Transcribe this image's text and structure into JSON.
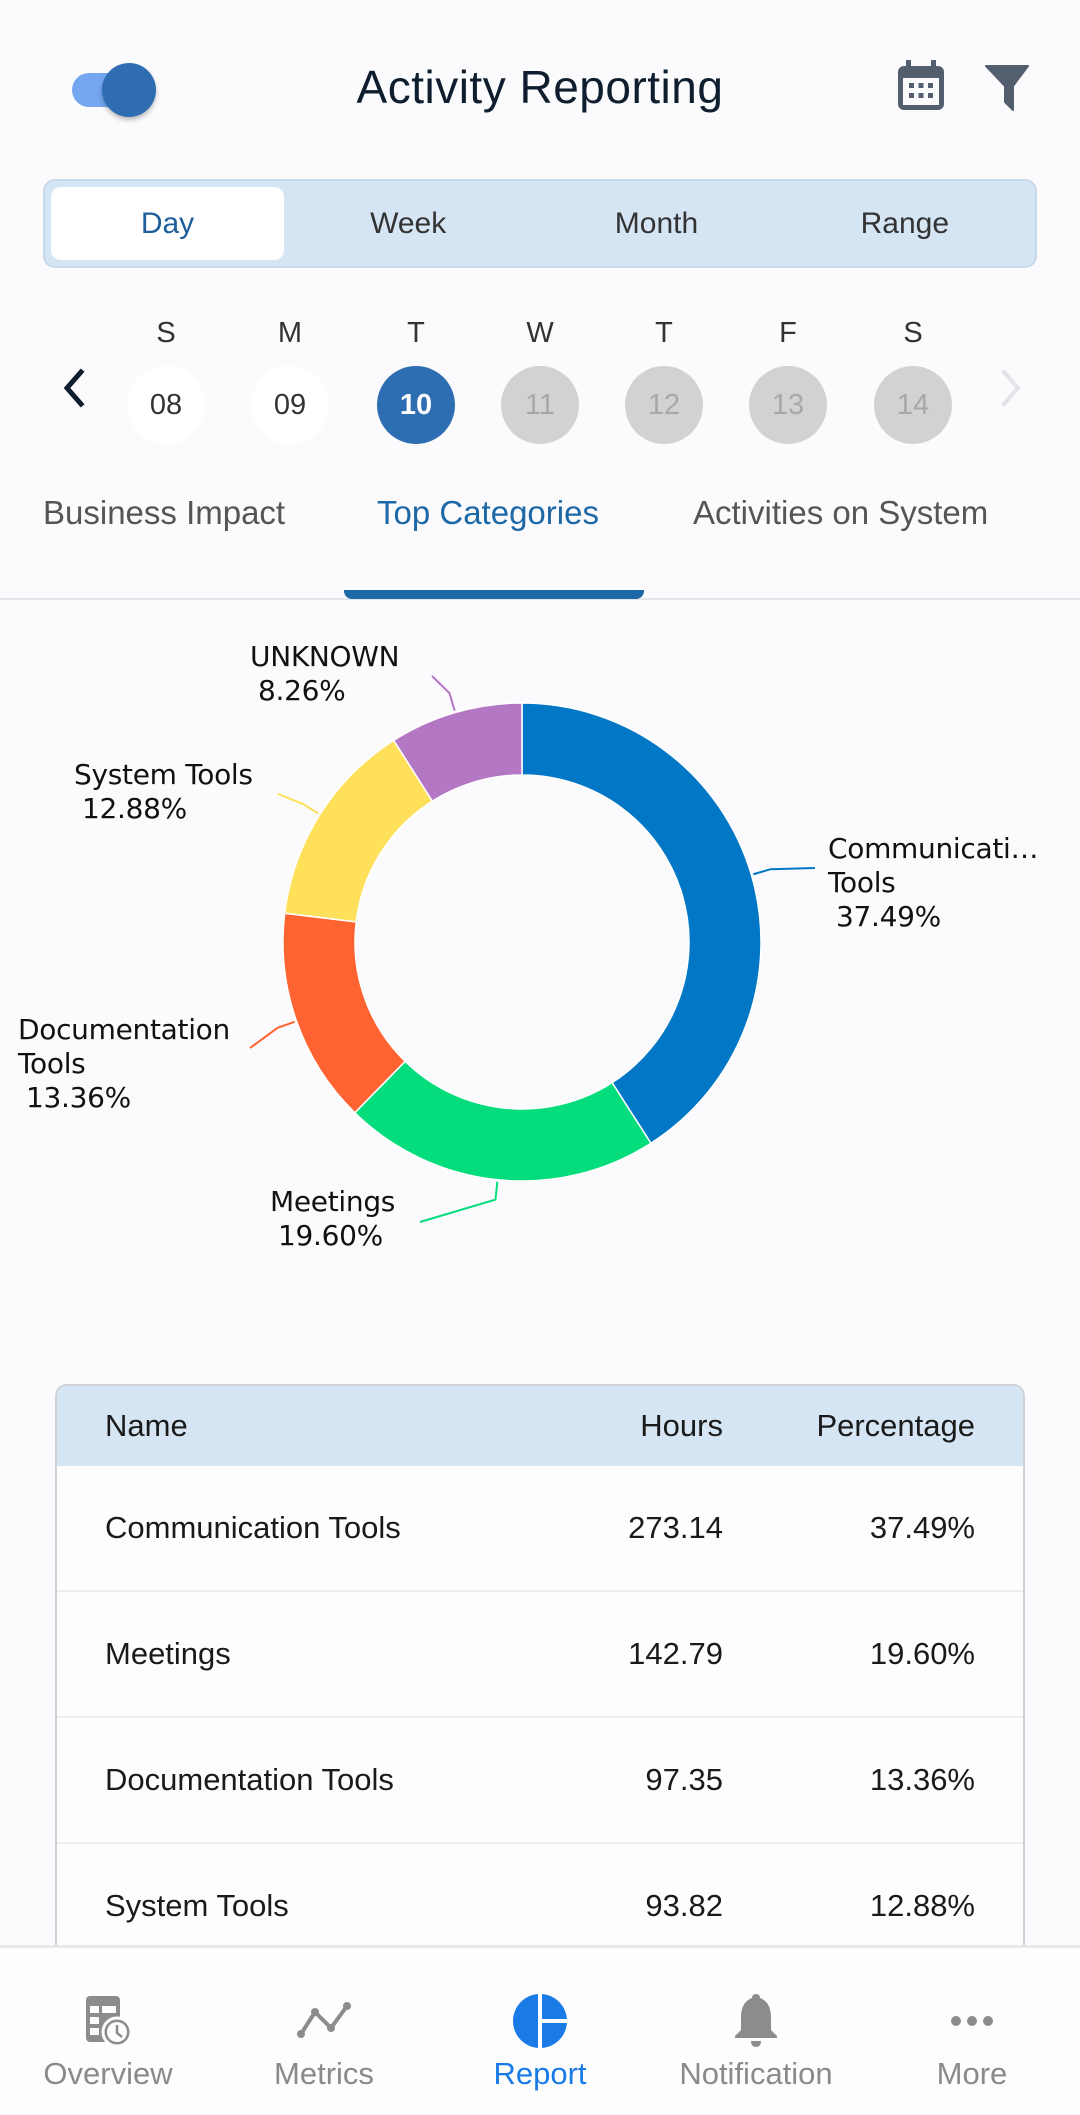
{
  "header": {
    "title": "Activity Reporting",
    "toggle_state": "on",
    "icons": [
      "calendar-icon",
      "filter-icon"
    ]
  },
  "period_tabs": [
    {
      "label": "Day",
      "active": true
    },
    {
      "label": "Week",
      "active": false
    },
    {
      "label": "Month",
      "active": false
    },
    {
      "label": "Range",
      "active": false
    }
  ],
  "date_strip": {
    "days": [
      {
        "dow": "S",
        "num": "08",
        "state": "past"
      },
      {
        "dow": "M",
        "num": "09",
        "state": "past"
      },
      {
        "dow": "T",
        "num": "10",
        "state": "selected"
      },
      {
        "dow": "W",
        "num": "11",
        "state": "future"
      },
      {
        "dow": "T",
        "num": "12",
        "state": "future"
      },
      {
        "dow": "F",
        "num": "13",
        "state": "future"
      },
      {
        "dow": "S",
        "num": "14",
        "state": "future"
      }
    ]
  },
  "sub_tabs": [
    {
      "label": "Business Impact",
      "active": false
    },
    {
      "label": "Top Categories",
      "active": true
    },
    {
      "label": "Activities on System",
      "active": false
    }
  ],
  "chart_data": {
    "type": "pie",
    "donut": true,
    "title": "",
    "start": "top",
    "direction": "clockwise",
    "slices": [
      {
        "name": "Communication Tools",
        "display_label": "Communicati… Tools",
        "value": 37.49,
        "label": "37.49%",
        "color": "#0277c5"
      },
      {
        "name": "Meetings",
        "display_label": "Meetings",
        "value": 19.6,
        "label": "19.60%",
        "color": "#05dd7d"
      },
      {
        "name": "Documentation Tools",
        "display_label": "Documentation Tools",
        "value": 13.36,
        "label": "13.36%",
        "color": "#ff6331"
      },
      {
        "name": "System Tools",
        "display_label": "System Tools",
        "value": 12.88,
        "label": "12.88%",
        "color": "#ffe05b"
      },
      {
        "name": "UNKNOWN",
        "display_label": "UNKNOWN",
        "value": 8.26,
        "label": "8.26%",
        "color": "#b377c3"
      }
    ]
  },
  "table": {
    "headers": {
      "name": "Name",
      "hours": "Hours",
      "percentage": "Percentage"
    },
    "rows": [
      {
        "name": "Communication Tools",
        "hours": "273.14",
        "percentage": "37.49%"
      },
      {
        "name": "Meetings",
        "hours": "142.79",
        "percentage": "19.60%"
      },
      {
        "name": "Documentation Tools",
        "hours": "97.35",
        "percentage": "13.36%"
      },
      {
        "name": "System Tools",
        "hours": "93.82",
        "percentage": "12.88%"
      }
    ]
  },
  "bottom_nav": [
    {
      "label": "Overview",
      "icon": "overview-icon",
      "active": false
    },
    {
      "label": "Metrics",
      "icon": "metrics-icon",
      "active": false
    },
    {
      "label": "Report",
      "icon": "report-icon",
      "active": true
    },
    {
      "label": "Notification",
      "icon": "bell-icon",
      "active": false
    },
    {
      "label": "More",
      "icon": "more-icon",
      "active": false
    }
  ],
  "colors": {
    "accent": "#1d68a6",
    "selected_day": "#2d6db1",
    "nav_active": "#1a7ae6",
    "segment_bg": "#d6e5f4"
  }
}
